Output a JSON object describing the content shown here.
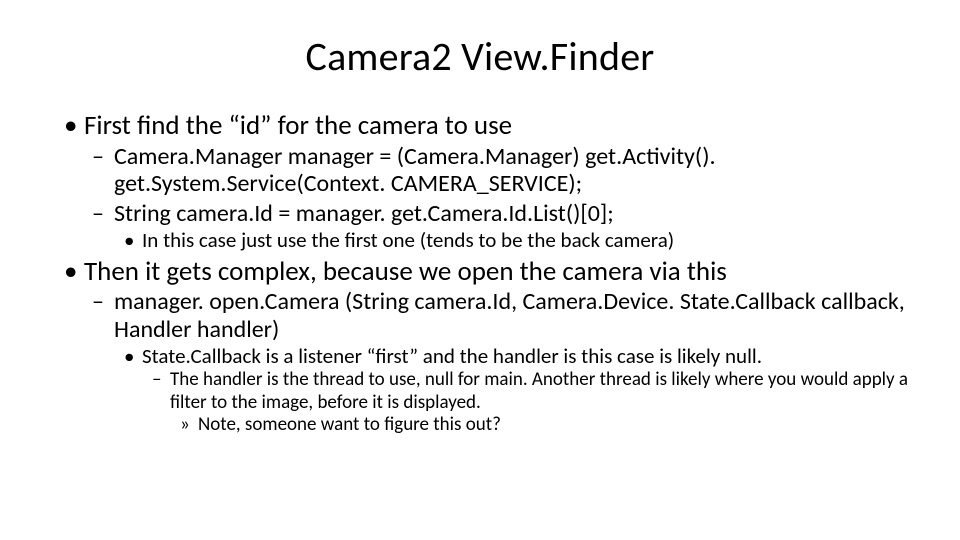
{
  "title": "Camera2 View.Finder",
  "bullets": {
    "b1": "First find the “id” for the camera to use",
    "b1a": "Camera.Manager manager = (Camera.Manager) get.Activity(). get.System.Service(Context. CAMERA_SERVICE);",
    "b1b": "String camera.Id = manager. get.Camera.Id.List()[0];",
    "b1b1": "In this case just use the first one (tends to be the back camera)",
    "b2": "Then it gets complex, because we open the camera via this",
    "b2a": "manager. open.Camera (String camera.Id, Camera.Device. State.Callback callback, Handler handler)",
    "b2a1": "State.Callback is a listener “first” and the handler is this case is likely null.",
    "b2a1a": "The handler is the thread to use, null for main.   Another thread is likely where you would apply a filter to the image, before it is displayed.",
    "b2a1a1": "Note, someone want to figure this out?"
  }
}
